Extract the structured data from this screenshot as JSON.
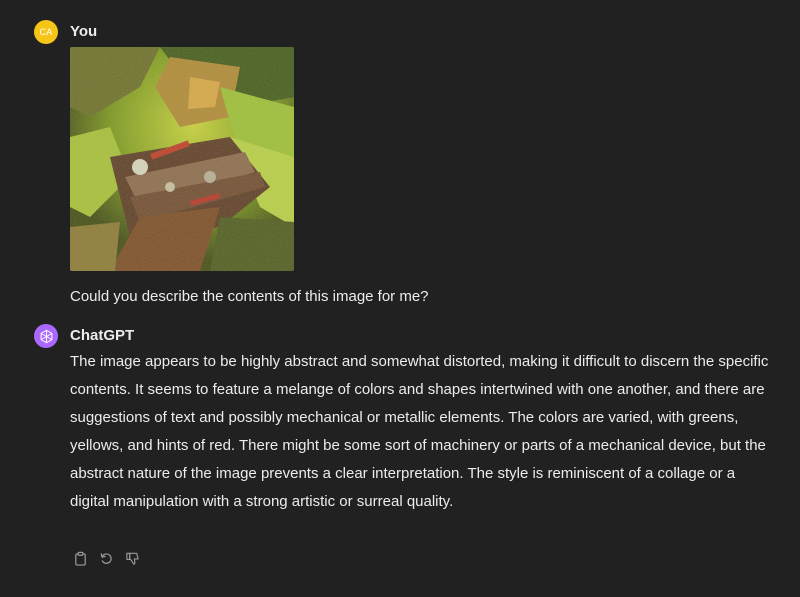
{
  "user_message": {
    "avatar_initials": "CA",
    "author": "You",
    "text": "Could you describe the contents of this image for me?",
    "image_description": "abstract distorted image with greens, yellows, reds and mechanical elements"
  },
  "assistant_message": {
    "author": "ChatGPT",
    "text": "The image appears to be highly abstract and somewhat distorted, making it difficult to discern the specific contents. It seems to feature a melange of colors and shapes intertwined with one another, and there are suggestions of text and possibly mechanical or metallic elements. The colors are varied, with greens, yellows, and hints of red. There might be some sort of machinery or parts of a mechanical device, but the abstract nature of the image prevents a clear interpretation. The style is reminiscent of a collage or a digital manipulation with a strong artistic or surreal quality."
  },
  "actions": [
    {
      "icon": "clipboard-icon"
    },
    {
      "icon": "regenerate-icon"
    },
    {
      "icon": "thumbs-down-icon"
    }
  ],
  "colors": {
    "background": "#212121",
    "text": "#ececec",
    "user_avatar": "#f5c518",
    "assistant_avatar": "#ab68ff",
    "icon": "#9b9b9b"
  }
}
